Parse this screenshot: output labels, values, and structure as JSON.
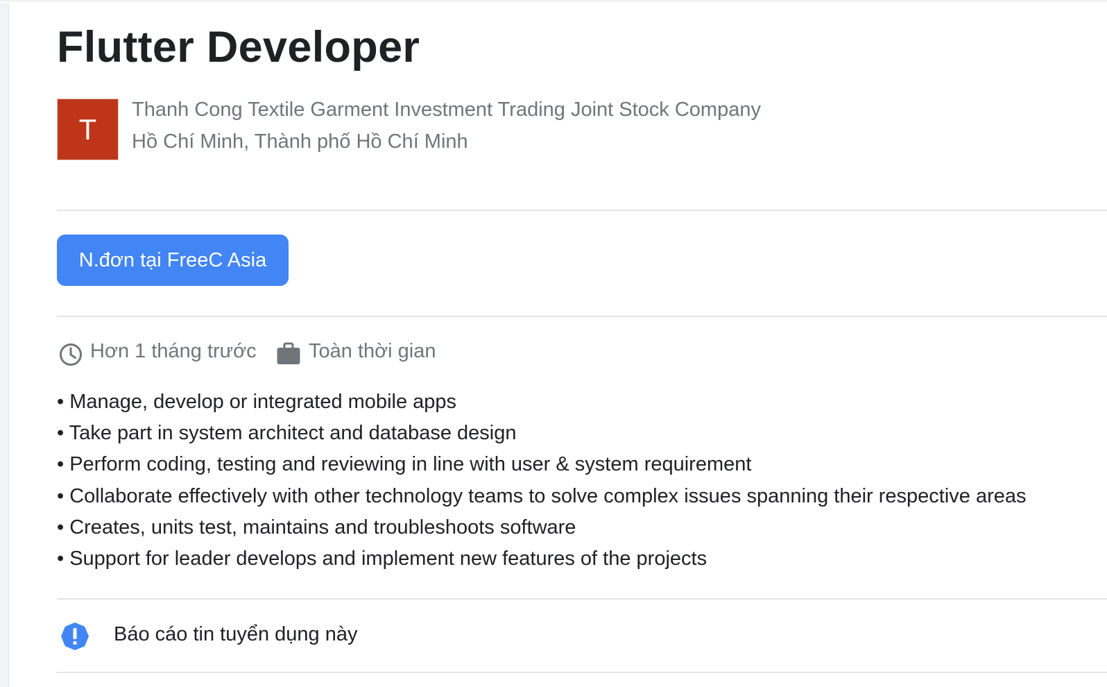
{
  "job": {
    "title": "Flutter Developer",
    "company_initial": "T",
    "company": "Thanh Cong Textile Garment Investment Trading Joint Stock Company",
    "location": "Hồ Chí Minh, Thành phố Hồ Chí Minh",
    "apply_label": "N.đơn tại FreeC Asia",
    "posted": "Hơn 1 tháng trước",
    "employment_type": "Toàn thời gian",
    "responsibilities": [
      "• Manage, develop or integrated mobile apps",
      "• Take part in system architect and database design",
      "• Perform coding, testing and reviewing in line with user & system requirement",
      "• Collaborate effectively with other technology teams to solve complex issues spanning their respective areas",
      "• Creates, units test, maintains and troubleshoots software",
      "• Support for leader develops and implement new features of the projects"
    ],
    "report_label": "Báo cáo tin tuyển dụng này"
  },
  "icons": {
    "posted": "clock-icon",
    "employment_type": "briefcase-icon",
    "report": "alert-badge-icon"
  },
  "colors": {
    "logo_background": "#bf3519",
    "apply_button": "#4285f4",
    "report_icon": "#4285f4",
    "secondary_text": "#70757a",
    "primary_text": "#202124"
  }
}
